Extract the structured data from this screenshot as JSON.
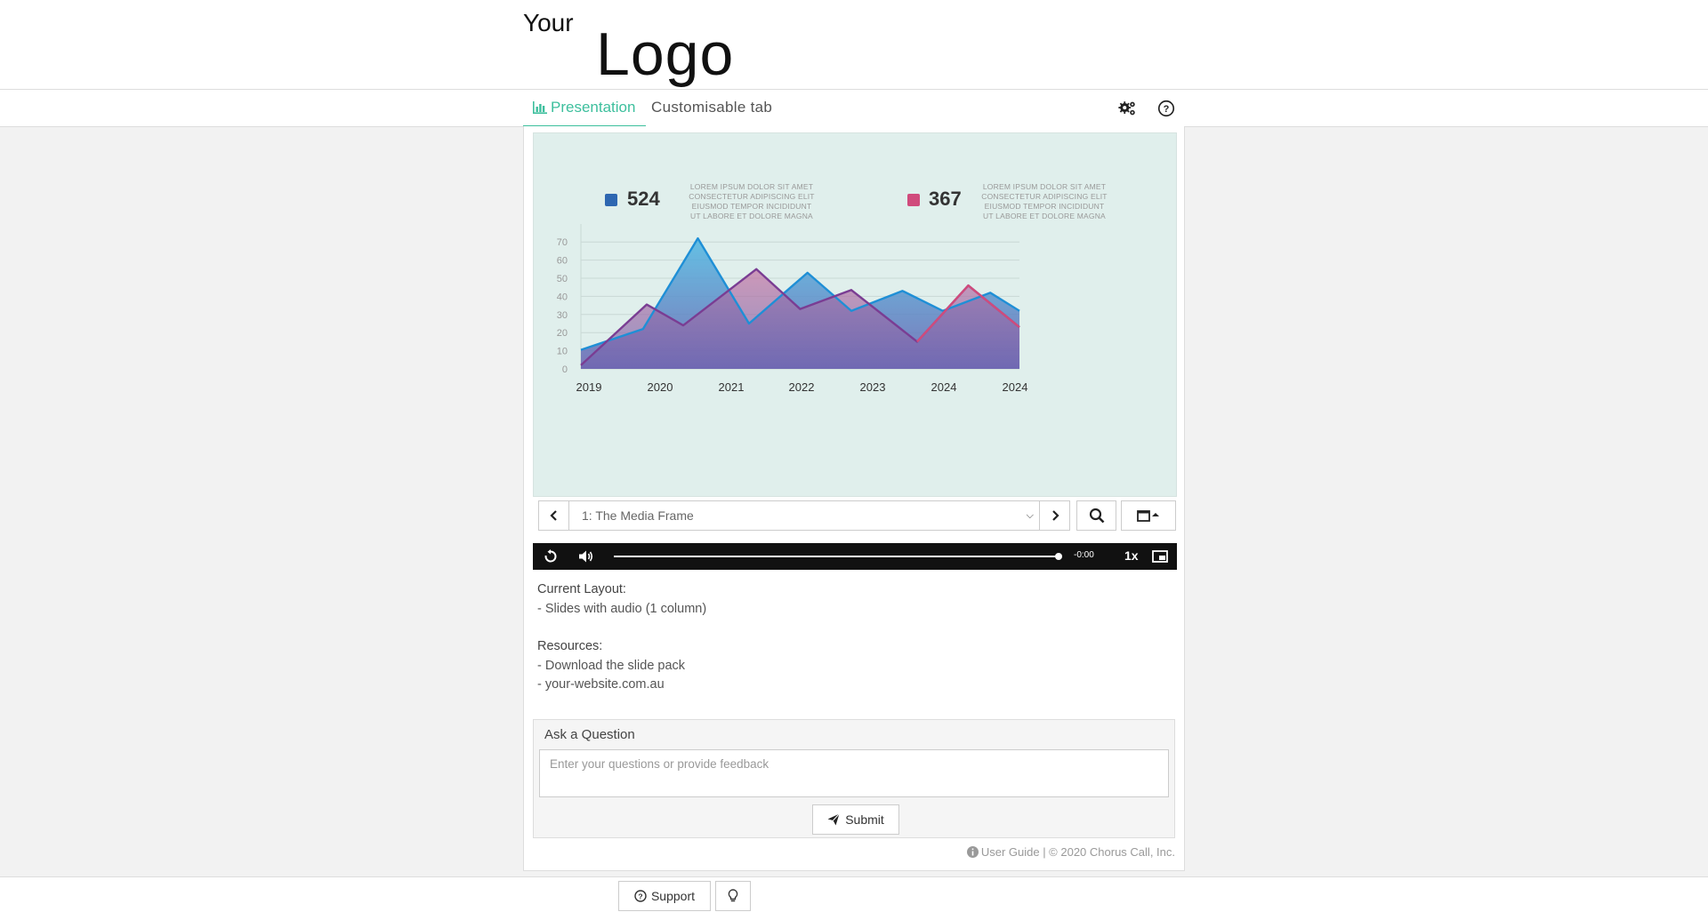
{
  "logo": {
    "small": "Your",
    "large": "Logo"
  },
  "tabs": [
    {
      "label": "Presentation",
      "active": true,
      "icon": "bar-chart-icon"
    },
    {
      "label": "Customisable tab",
      "active": false
    }
  ],
  "header_icons": [
    "settings-gears-icon",
    "help-icon"
  ],
  "colors": {
    "accent": "#3dbf9d",
    "slide_bg": "#e0efec",
    "series_blue": "#3c6fb6",
    "series_pink": "#d04b7c"
  },
  "slide": {
    "stats": [
      {
        "value": "524",
        "color": "#2e67b1",
        "text": [
          "LOREM IPSUM DOLOR SIT AMET",
          "CONSECTETUR ADIPISCING ELIT",
          "EIUSMOD TEMPOR  INCIDIDUNT",
          "UT LABORE ET DOLORE MAGNA"
        ]
      },
      {
        "value": "367",
        "color": "#d04b7c",
        "text": [
          "LOREM IPSUM DOLOR SIT AMET",
          "CONSECTETUR ADIPISCING ELIT",
          "EIUSMOD TEMPOR  INCIDIDUNT",
          "UT LABORE ET DOLORE MAGNA"
        ]
      }
    ]
  },
  "chart_data": {
    "type": "area",
    "title": "",
    "xlabel": "",
    "ylabel": "",
    "categories": [
      "2019",
      "2020",
      "2021",
      "2022",
      "2023",
      "2024",
      "2024"
    ],
    "yticks": [
      0,
      10,
      20,
      30,
      40,
      50,
      60,
      70
    ],
    "ylim": [
      0,
      75
    ],
    "xlim": [
      0,
      6
    ],
    "grid": true,
    "series": [
      {
        "color_line": "#1f8fd6",
        "color_fill_top": "#4fb8e3",
        "points": [
          [
            0,
            10.5
          ],
          [
            0.85,
            22
          ],
          [
            1.6,
            72
          ],
          [
            2.3,
            25
          ],
          [
            3.1,
            53
          ],
          [
            3.7,
            32
          ],
          [
            4.4,
            43
          ],
          [
            4.95,
            32
          ],
          [
            5.6,
            42
          ],
          [
            6,
            32
          ]
        ]
      },
      {
        "color_line": "#7a3d93",
        "color_fill_top": "#c46e9f",
        "points": [
          [
            0,
            2
          ],
          [
            0.9,
            35.5
          ],
          [
            1.4,
            24
          ],
          [
            2.4,
            55
          ],
          [
            3.0,
            33
          ],
          [
            3.7,
            43.5
          ],
          [
            4.6,
            15
          ],
          [
            5.3,
            46
          ],
          [
            6,
            23
          ]
        ]
      }
    ]
  },
  "controls": {
    "slide_select_value": "1: The Media Frame"
  },
  "player": {
    "time": "-0:00",
    "speed": "1x",
    "progress": 1.0
  },
  "info": {
    "layout_heading": "Current Layout:",
    "layout_value": "- Slides with audio (1 column)",
    "resources_heading": "Resources:",
    "resources": [
      "- Download the slide pack",
      "- your-website.com.au"
    ]
  },
  "ask": {
    "title": "Ask a Question",
    "placeholder": "Enter your questions or provide feedback",
    "submit_label": "Submit"
  },
  "footer_note": "User Guide | © 2020 Chorus Call, Inc.",
  "bottom": {
    "support_label": "Support"
  }
}
